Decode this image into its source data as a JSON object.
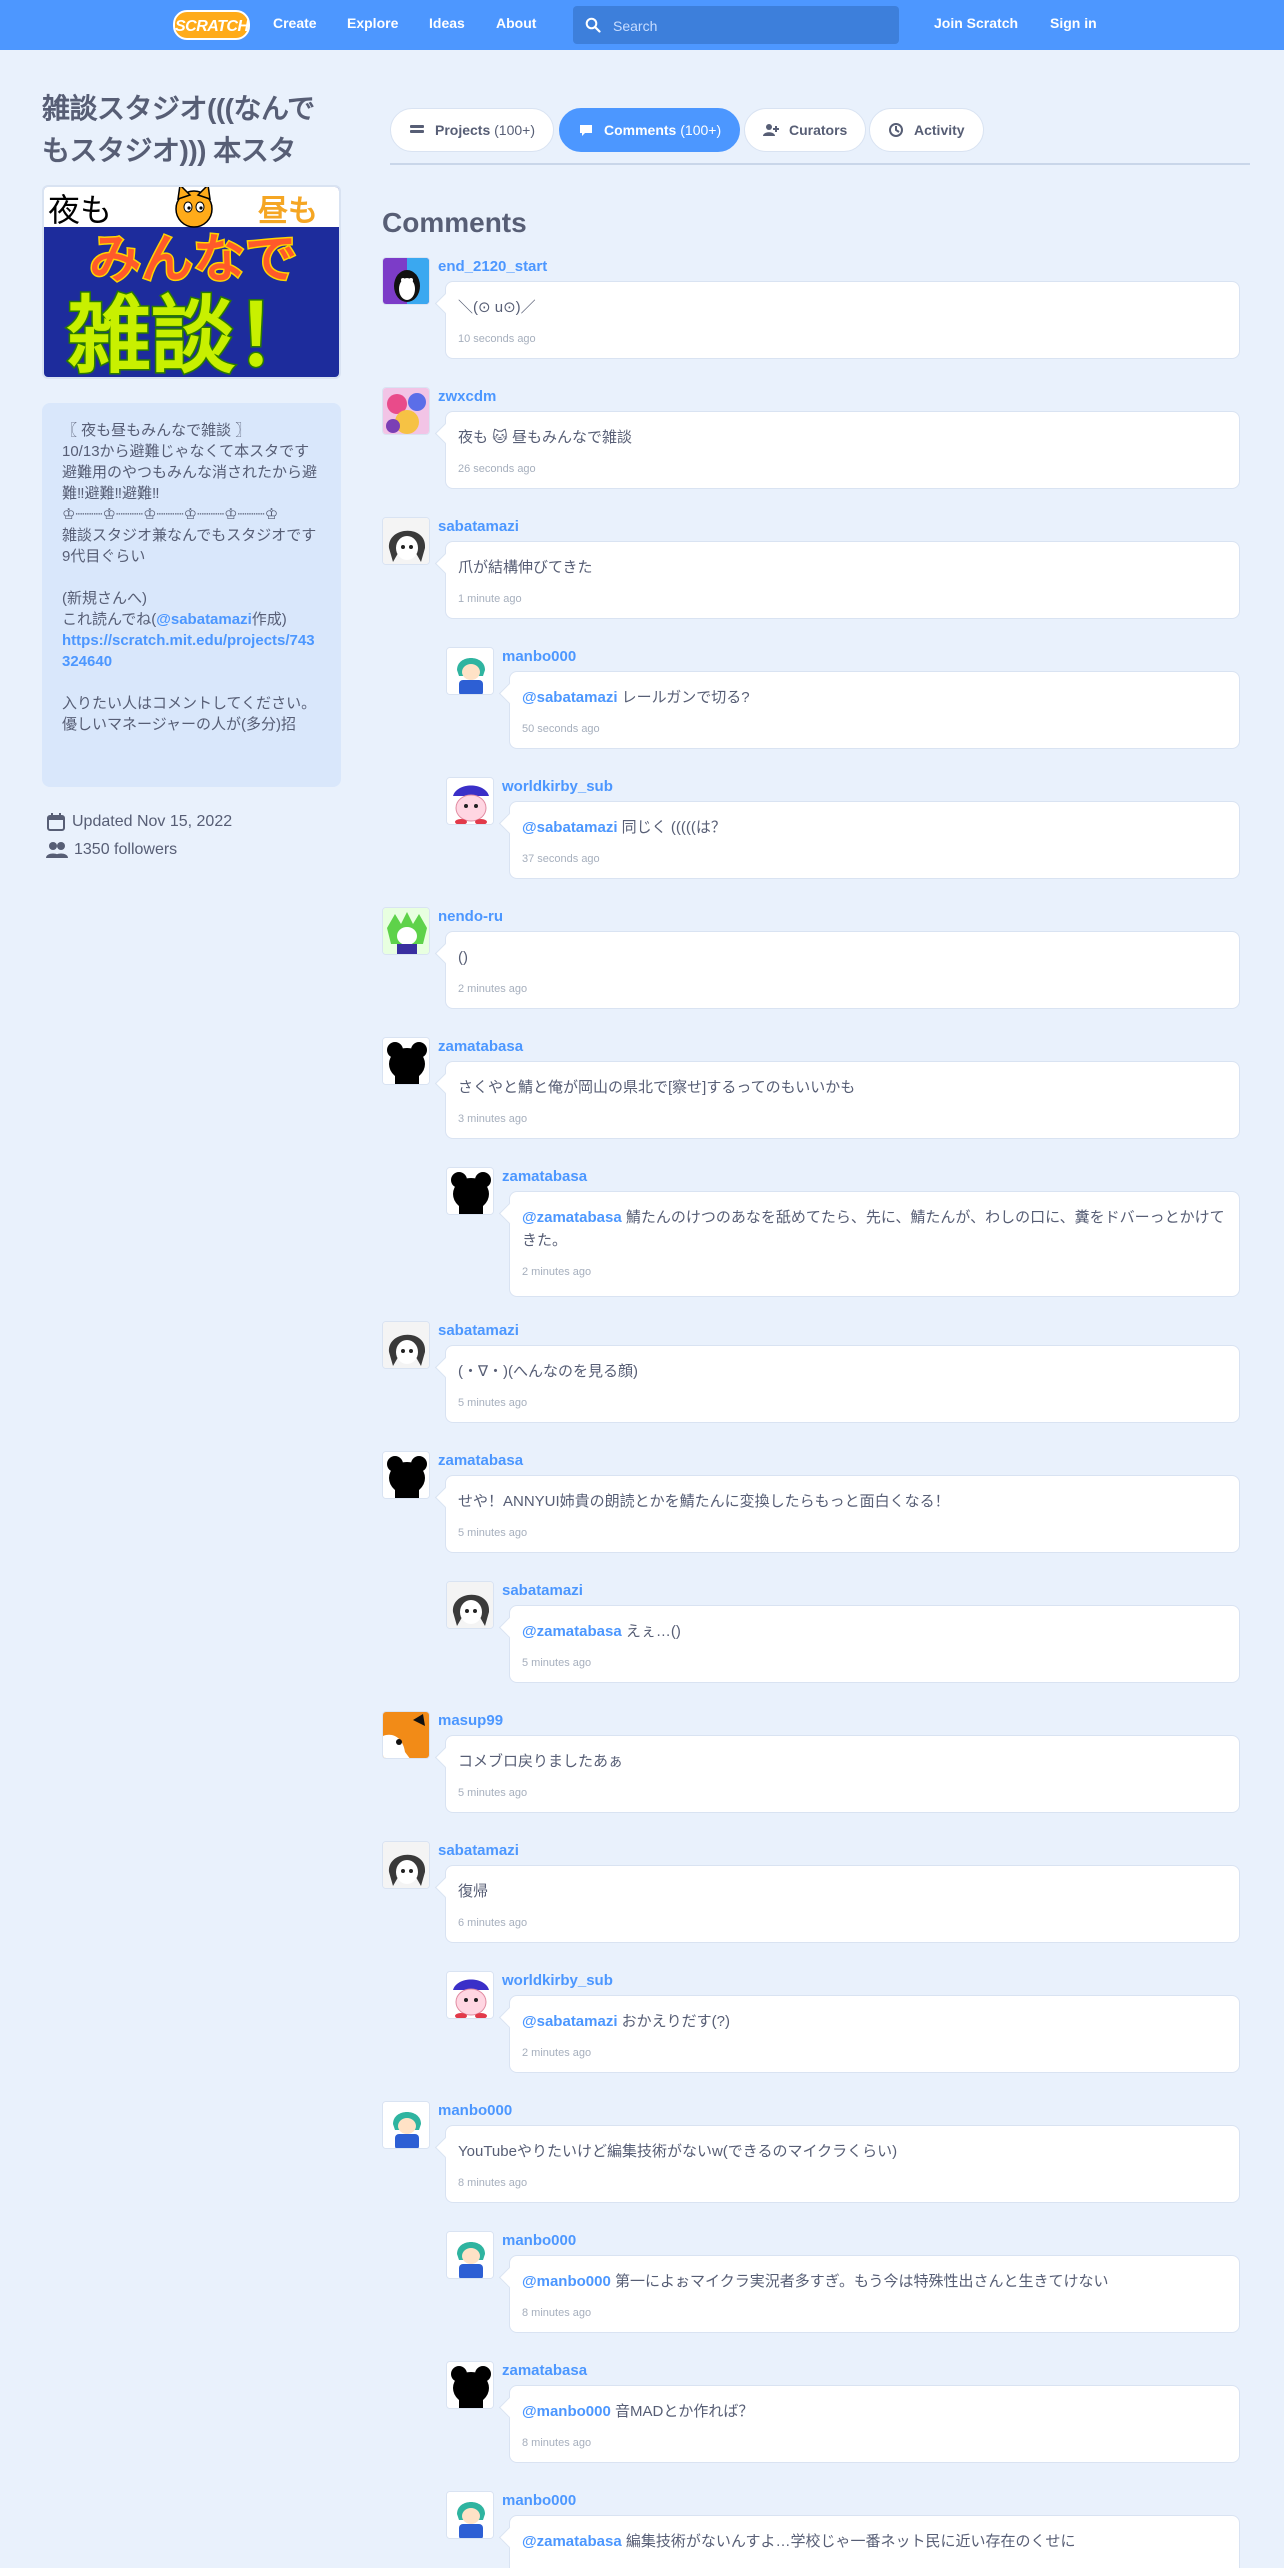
{
  "nav": {
    "logo": "SCRATCH",
    "links": [
      "Create",
      "Explore",
      "Ideas",
      "About"
    ],
    "search_placeholder": "Search",
    "join": "Join Scratch",
    "signin": "Sign in",
    "color": "#4d97ff"
  },
  "studio": {
    "title": "雑談スタジオ(((なんでもスタジオ))) 本スタ",
    "thumbnail": {
      "top_left": "夜も",
      "top_right": "昼も",
      "line1": "みんなで",
      "line2": "雑談！"
    },
    "description_lines": [
      "〖 夜も昼もみんなで雑談 〗",
      "10/13から避難じゃなくて本スタです",
      "避難用のやつもみんな消されたから避難‼避難‼避難‼",
      "♔┈┈┈♔┈┈┈♔┈┈┈♔┈┈┈♔┈┈┈♔",
      "雑談スタジオ兼なんでもスタジオです",
      "9代目ぐらい",
      "",
      "(新規さんへ)"
    ],
    "desc_read_prefix": "これ読んでね(",
    "desc_read_mention": "@sabatamazi",
    "desc_read_suffix": "作成)",
    "desc_link": "https://scratch.mit.edu/projects/743324640",
    "desc_after_lines": [
      "",
      "入りたい人はコメントしてください。",
      "優しいマネージャーの人が(多分)招"
    ],
    "updated": "Updated Nov 15, 2022",
    "followers": "1350 followers"
  },
  "tabs": [
    {
      "label": "Projects",
      "count": "(100+)",
      "active": false
    },
    {
      "label": "Comments",
      "count": "(100+)",
      "active": true
    },
    {
      "label": "Curators",
      "count": "",
      "active": false
    },
    {
      "label": "Activity",
      "count": "",
      "active": false
    }
  ],
  "comments_heading": "Comments",
  "comments": [
    {
      "user": "end_2120_start",
      "avatar": "penguin",
      "mention": "",
      "text": "＼(⊙ u⊙)／",
      "time": "10 seconds ago",
      "reply": false
    },
    {
      "user": "zwxcdm",
      "avatar": "colorful",
      "mention": "",
      "text": "夜も 🐱 昼もみんなで雑談",
      "time": "26 seconds ago",
      "reply": false
    },
    {
      "user": "sabatamazi",
      "avatar": "grayhair",
      "mention": "",
      "text": "爪が結構伸びてきた",
      "time": "1 minute ago",
      "reply": false
    },
    {
      "user": "manbo000",
      "avatar": "greenhair",
      "mention": "@sabatamazi",
      "text": " レールガンで切る?",
      "time": "50 seconds ago",
      "reply": true
    },
    {
      "user": "worldkirby_sub",
      "avatar": "kirby",
      "mention": "@sabatamazi",
      "text": " 同じく (((((は？",
      "time": "37 seconds ago",
      "reply": true
    },
    {
      "user": "nendo-ru",
      "avatar": "greenchar",
      "mention": "",
      "text": "()",
      "time": "2 minutes ago",
      "reply": false
    },
    {
      "user": "zamatabasa",
      "avatar": "black",
      "mention": "",
      "text": "さくやと鯖と俺が岡山の県北で[察せ]するってのもいいかも",
      "time": "3 minutes ago",
      "reply": false
    },
    {
      "user": "zamatabasa",
      "avatar": "black",
      "mention": "@zamatabasa",
      "text": " 鯖たんのけつのあなを舐めてたら、先に、鯖たんが、わしの口に、糞をドバーっとかけてきた。",
      "time": "2 minutes ago",
      "reply": true
    },
    {
      "user": "sabatamazi",
      "avatar": "grayhair",
      "mention": "",
      "text": "(・∇・)(へんなのを見る顔)",
      "time": "5 minutes ago",
      "reply": false
    },
    {
      "user": "zamatabasa",
      "avatar": "black",
      "mention": "",
      "text": "せや！ANNYUI姉貴の朗読とかを鯖たんに変換したらもっと面白くなる！",
      "time": "5 minutes ago",
      "reply": false
    },
    {
      "user": "sabatamazi",
      "avatar": "grayhair",
      "mention": "@zamatabasa",
      "text": " えぇ…()",
      "time": "5 minutes ago",
      "reply": true
    },
    {
      "user": "masup99",
      "avatar": "orangecat",
      "mention": "",
      "text": "コメブロ戻りましたあぁ",
      "time": "5 minutes ago",
      "reply": false
    },
    {
      "user": "sabatamazi",
      "avatar": "grayhair",
      "mention": "",
      "text": "復帰",
      "time": "6 minutes ago",
      "reply": false
    },
    {
      "user": "worldkirby_sub",
      "avatar": "kirby",
      "mention": "@sabatamazi",
      "text": " おかえりだす(?)",
      "time": "2 minutes ago",
      "reply": true
    },
    {
      "user": "manbo000",
      "avatar": "greenhair",
      "mention": "",
      "text": "YouTubeやりたいけど編集技術がないw(できるのマイクラくらい)",
      "time": "8 minutes ago",
      "reply": false
    },
    {
      "user": "manbo000",
      "avatar": "greenhair",
      "mention": "@manbo000",
      "text": " 第一によぉマイクラ実況者多すぎ。もう今は特殊性出さんと生きてけない",
      "time": "8 minutes ago",
      "reply": true
    },
    {
      "user": "zamatabasa",
      "avatar": "black",
      "mention": "@manbo000",
      "text": " 音MADとか作れば？",
      "time": "8 minutes ago",
      "reply": true
    },
    {
      "user": "manbo000",
      "avatar": "greenhair",
      "mention": "@zamatabasa",
      "text": " 編集技術がないんすよ…学校じゃ一番ネット民に近い存在のくせに",
      "time": "",
      "reply": true
    }
  ]
}
